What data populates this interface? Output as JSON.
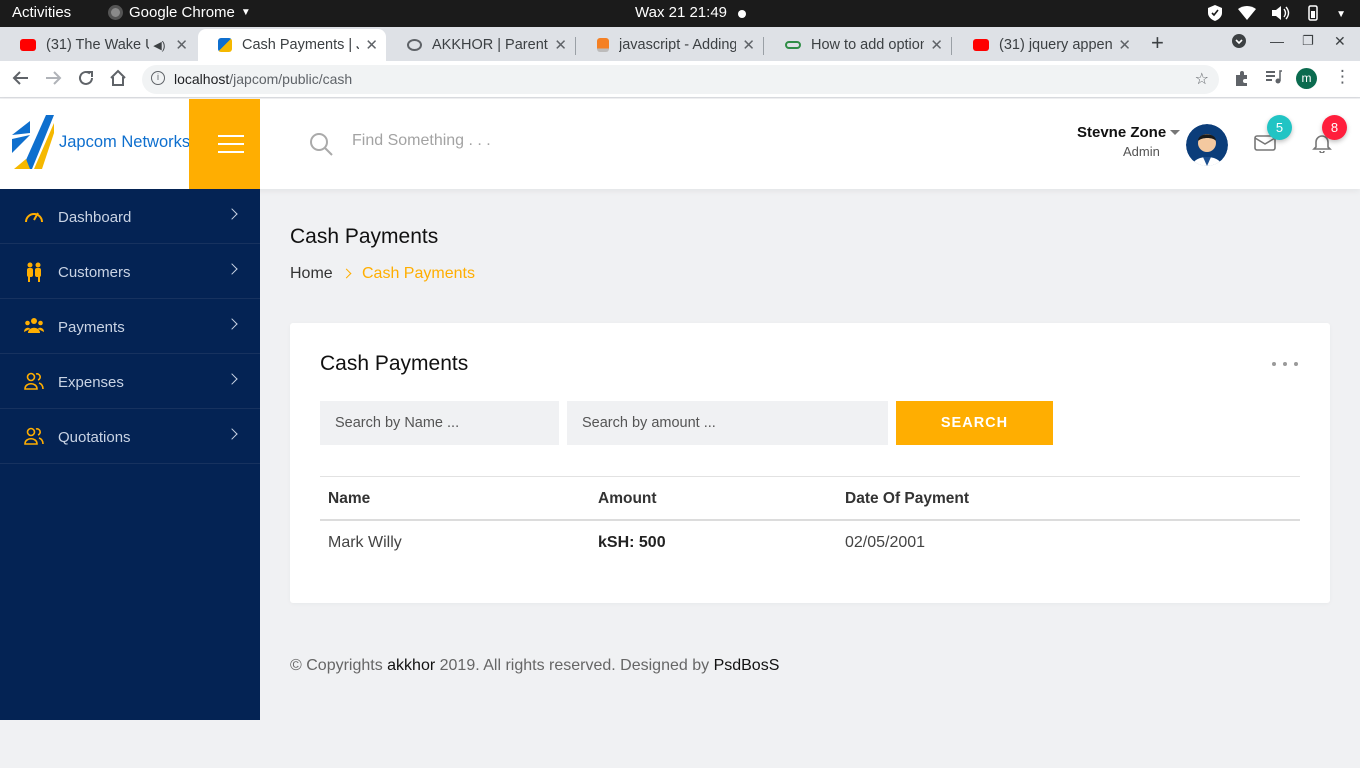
{
  "os_bar": {
    "activities": "Activities",
    "app_name": "Google Chrome",
    "clock": "Wax 21  21:49"
  },
  "browser": {
    "tabs": [
      {
        "title": "(31) The Wake U",
        "favicon": "youtube-icon"
      },
      {
        "title": "Cash Payments | Ja",
        "favicon": "japcom-icon"
      },
      {
        "title": "AKKHOR | Parents",
        "favicon": "akkhor-icon"
      },
      {
        "title": "javascript - Adding",
        "favicon": "stackoverflow-icon"
      },
      {
        "title": "How to add option",
        "favicon": "geeksforgeeks-icon"
      },
      {
        "title": "(31) jquery append",
        "favicon": "youtube-icon"
      }
    ],
    "url_host": "localhost",
    "url_path": "/japcom/public/cash",
    "profile_initial": "m"
  },
  "header": {
    "brand": "Japcom Networks",
    "search_placeholder": "Find Something . . .",
    "user_name": "Stevne Zone",
    "user_role": "Admin",
    "messages_count": "5",
    "notifications_count": "8"
  },
  "sidebar": {
    "items": [
      {
        "label": "Dashboard",
        "icon": "speedometer-icon"
      },
      {
        "label": "Customers",
        "icon": "people-icon"
      },
      {
        "label": "Payments",
        "icon": "group-icon"
      },
      {
        "label": "Expenses",
        "icon": "users-outline-icon"
      },
      {
        "label": "Quotations",
        "icon": "users-outline-icon"
      }
    ]
  },
  "page": {
    "title": "Cash Payments",
    "breadcrumb_home": "Home",
    "breadcrumb_current": "Cash Payments"
  },
  "card": {
    "title": "Cash Payments",
    "name_placeholder": "Search by Name ...",
    "amount_placeholder": "Search by amount ...",
    "search_label": "SEARCH",
    "columns": [
      "Name",
      "Amount",
      "Date Of Payment"
    ],
    "rows": [
      {
        "name": "Mark Willy",
        "amount": "kSH: 500",
        "date": "02/05/2001"
      }
    ]
  },
  "footer": {
    "prefix": "© Copyrights ",
    "link1": "akkhor",
    "middle": " 2019. All rights reserved. Designed by ",
    "link2": "PsdBosS"
  },
  "colors": {
    "accent": "#ffae01",
    "sidebar_bg": "#042354",
    "brand_blue": "#0e6fce",
    "badge_teal": "#21c4c4",
    "badge_red": "#ff1e3c"
  }
}
